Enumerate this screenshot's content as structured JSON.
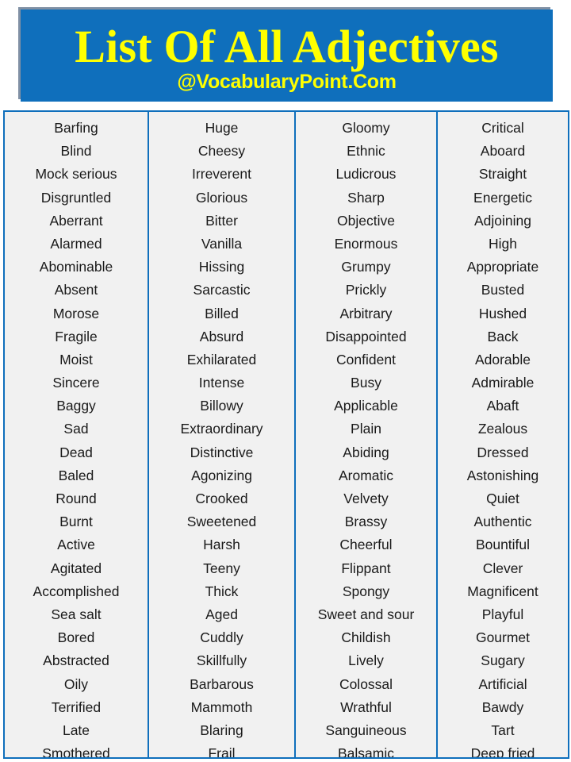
{
  "header": {
    "title": "List Of All Adjectives",
    "subtitle": "@VocabularyPoint.Com",
    "banner_color": "#0f6fbc",
    "text_color": "#ffff00"
  },
  "table": {
    "border_color": "#0f6fbc",
    "background_color": "#f1f1f1",
    "divider_color": "#0f6fbc",
    "column_count": 4,
    "row_count": 27,
    "columns": [
      {
        "name": "column-1",
        "words": [
          "Barfing",
          "Blind",
          "Mock serious",
          "Disgruntled",
          "Aberrant",
          "Alarmed",
          "Abominable",
          "Absent",
          "Morose",
          "Fragile",
          "Moist",
          "Sincere",
          "Baggy",
          "Sad",
          "Dead",
          "Baled",
          "Round",
          "Burnt",
          "Active",
          "Agitated",
          "Accomplished",
          "Sea salt",
          "Bored",
          "Abstracted",
          "Oily",
          "Terrified",
          "Late",
          "Smothered"
        ]
      },
      {
        "name": "column-2",
        "words": [
          "Huge",
          "Cheesy",
          "Irreverent",
          "Glorious",
          "Bitter",
          "Vanilla",
          "Hissing",
          "Sarcastic",
          "Billed",
          "Absurd",
          "Exhilarated",
          "Intense",
          "Billowy",
          "Extraordinary",
          "Distinctive",
          "Agonizing",
          "Crooked",
          "Sweetened",
          "Harsh",
          "Teeny",
          "Thick",
          "Aged",
          "Cuddly",
          "Skillfully",
          "Barbarous",
          "Mammoth",
          "Blaring",
          "Frail"
        ]
      },
      {
        "name": "column-3",
        "words": [
          "Gloomy",
          "Ethnic",
          "Ludicrous",
          "Sharp",
          "Objective",
          "Enormous",
          "Grumpy",
          "Prickly",
          "Arbitrary",
          "Disappointed",
          "Confident",
          "Busy",
          "Applicable",
          "Plain",
          "Abiding",
          "Aromatic",
          "Velvety",
          "Brassy",
          "Cheerful",
          "Flippant",
          "Spongy",
          "Sweet and sour",
          "Childish",
          "Lively",
          "Colossal",
          "Wrathful",
          "Sanguineous",
          "Balsamic"
        ]
      },
      {
        "name": "column-4",
        "words": [
          "Critical",
          "Aboard",
          "Straight",
          "Energetic",
          "Adjoining",
          "High",
          "Appropriate",
          "Busted",
          "Hushed",
          "Back",
          "Adorable",
          "Admirable",
          "Abaft",
          "Zealous",
          "Dressed",
          "Astonishing",
          "Quiet",
          "Authentic",
          "Bountiful",
          "Clever",
          "Magnificent",
          "Playful",
          "Gourmet",
          "Sugary",
          "Artificial",
          "Bawdy",
          "Tart",
          "Deep fried"
        ]
      }
    ]
  }
}
